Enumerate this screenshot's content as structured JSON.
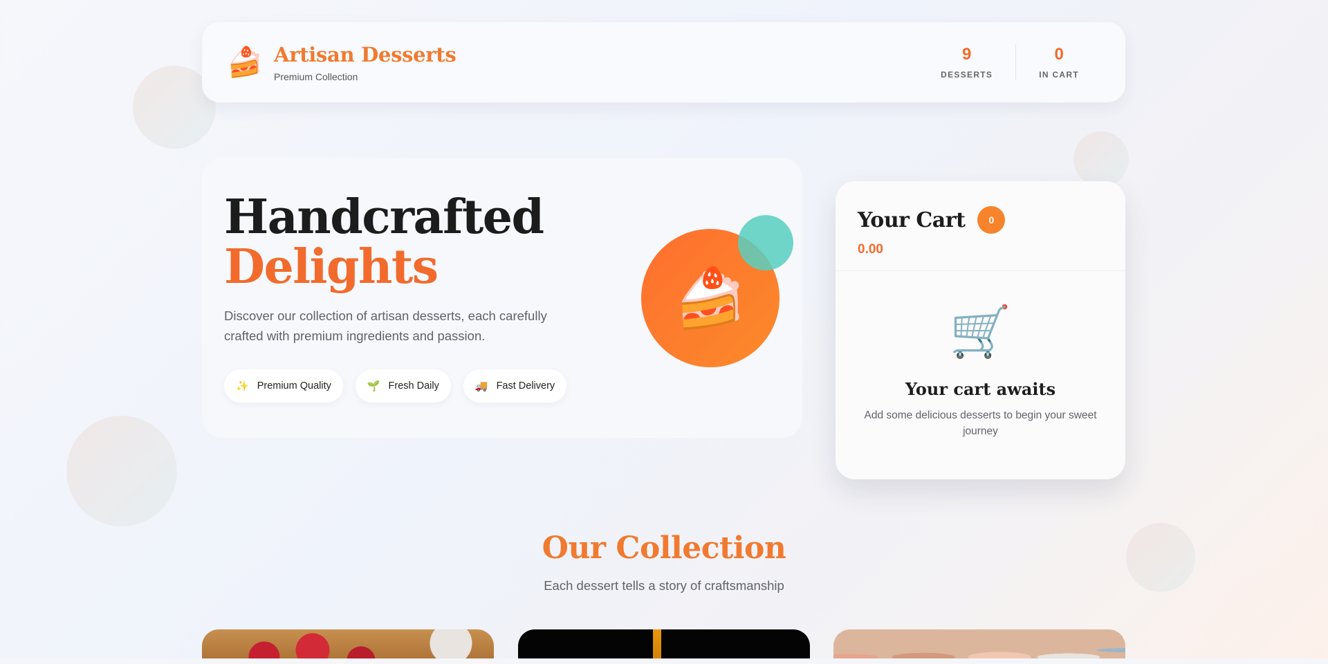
{
  "header": {
    "brand_icon": "cake-icon",
    "brand_glyph": "🍰",
    "title": "Artisan Desserts",
    "subtitle": "Premium Collection",
    "stats": [
      {
        "value": "9",
        "label": "DESSERTS"
      },
      {
        "value": "0",
        "label": "IN CART"
      }
    ]
  },
  "hero": {
    "title_line1": "Handcrafted",
    "title_line2": "Delights",
    "description": "Discover our collection of artisan desserts, each carefully crafted with premium ingredients and passion.",
    "features": [
      {
        "icon": "sparkles-icon",
        "glyph": "✨",
        "label": "Premium Quality"
      },
      {
        "icon": "seedling-icon",
        "glyph": "🌱",
        "label": "Fresh Daily"
      },
      {
        "icon": "truck-icon",
        "glyph": "🚚",
        "label": "Fast Delivery"
      }
    ],
    "illustration_icon": "cake-icon",
    "illustration_glyph": "🍰"
  },
  "cart": {
    "title": "Your Cart",
    "count": "0",
    "total": "0.00",
    "empty_icon": "shopping-cart-icon",
    "empty_glyph": "🛒",
    "empty_title": "Your cart awaits",
    "empty_text": "Add some delicious desserts to begin your sweet journey"
  },
  "collection": {
    "title": "Our Collection",
    "subtitle": "Each dessert tells a story of craftsmanship"
  },
  "colors": {
    "accent": "#f26b2c",
    "accent_light": "#f7832a",
    "teal": "#58cfc0"
  }
}
